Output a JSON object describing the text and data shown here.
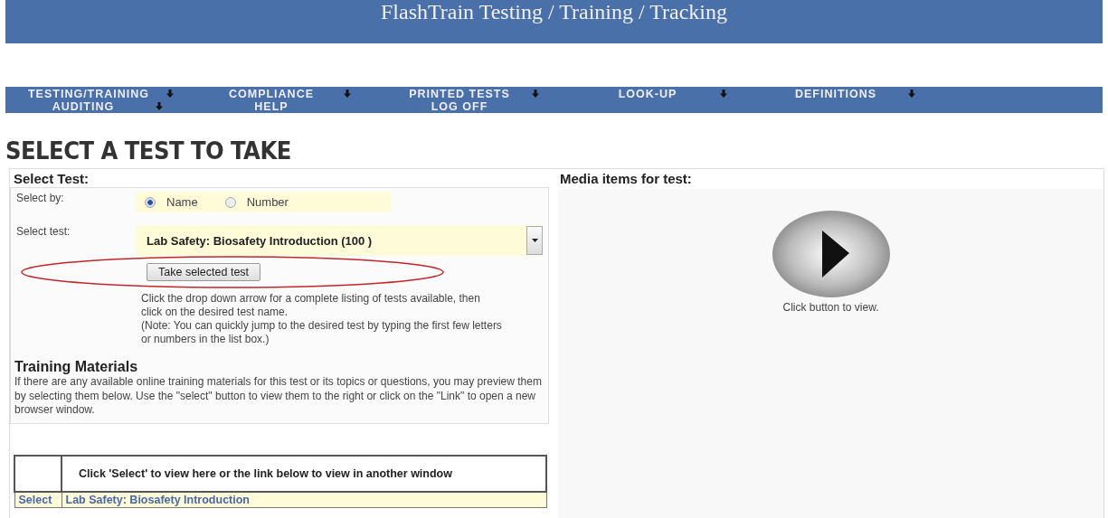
{
  "header": {
    "title": "FlashTrain Testing / Training / Tracking"
  },
  "menu": [
    {
      "label": "TESTING/TRAINING",
      "has_submenu": true
    },
    {
      "label": "COMPLIANCE",
      "has_submenu": true
    },
    {
      "label": "PRINTED TESTS",
      "has_submenu": true
    },
    {
      "label": "LOOK-UP",
      "has_submenu": true
    },
    {
      "label": "DEFINITIONS",
      "has_submenu": true
    },
    {
      "label": "AUDITING",
      "has_submenu": true
    },
    {
      "label": "HELP",
      "has_submenu": false
    },
    {
      "label": "LOG OFF",
      "has_submenu": false
    }
  ],
  "page_title": "SELECT A TEST TO TAKE",
  "select_panel": {
    "title": "Select Test:",
    "select_by_label": "Select by:",
    "select_by_options": [
      {
        "label": "Name",
        "selected": true
      },
      {
        "label": "Number",
        "selected": false
      }
    ],
    "select_test_label": "Select test:",
    "select_test_value": "Lab Safety: Biosafety Introduction (100 )",
    "take_button": "Take selected test",
    "button_highlighted": true,
    "help_lines": [
      "Click the drop down arrow for a complete listing of tests available, then click on the desired test name.",
      "(Note:  You can quickly jump to the desired test by typing the first few letters or numbers in the list box.)"
    ]
  },
  "training": {
    "title": "Training Materials",
    "text": "If there are any available online training materials for this test or its topics or questions, you may preview them by selecting them below.  Use the \"select\" button to view them to the right or click on the \"Link\" to open a new browser window.",
    "table_header": "Click 'Select' to view here or the link below to view in another window",
    "rows": [
      {
        "action": "Select",
        "link": "Lab Safety: Biosafety Introduction"
      }
    ]
  },
  "media_panel": {
    "title": "Media items for test:",
    "caption": "Click button to view."
  }
}
